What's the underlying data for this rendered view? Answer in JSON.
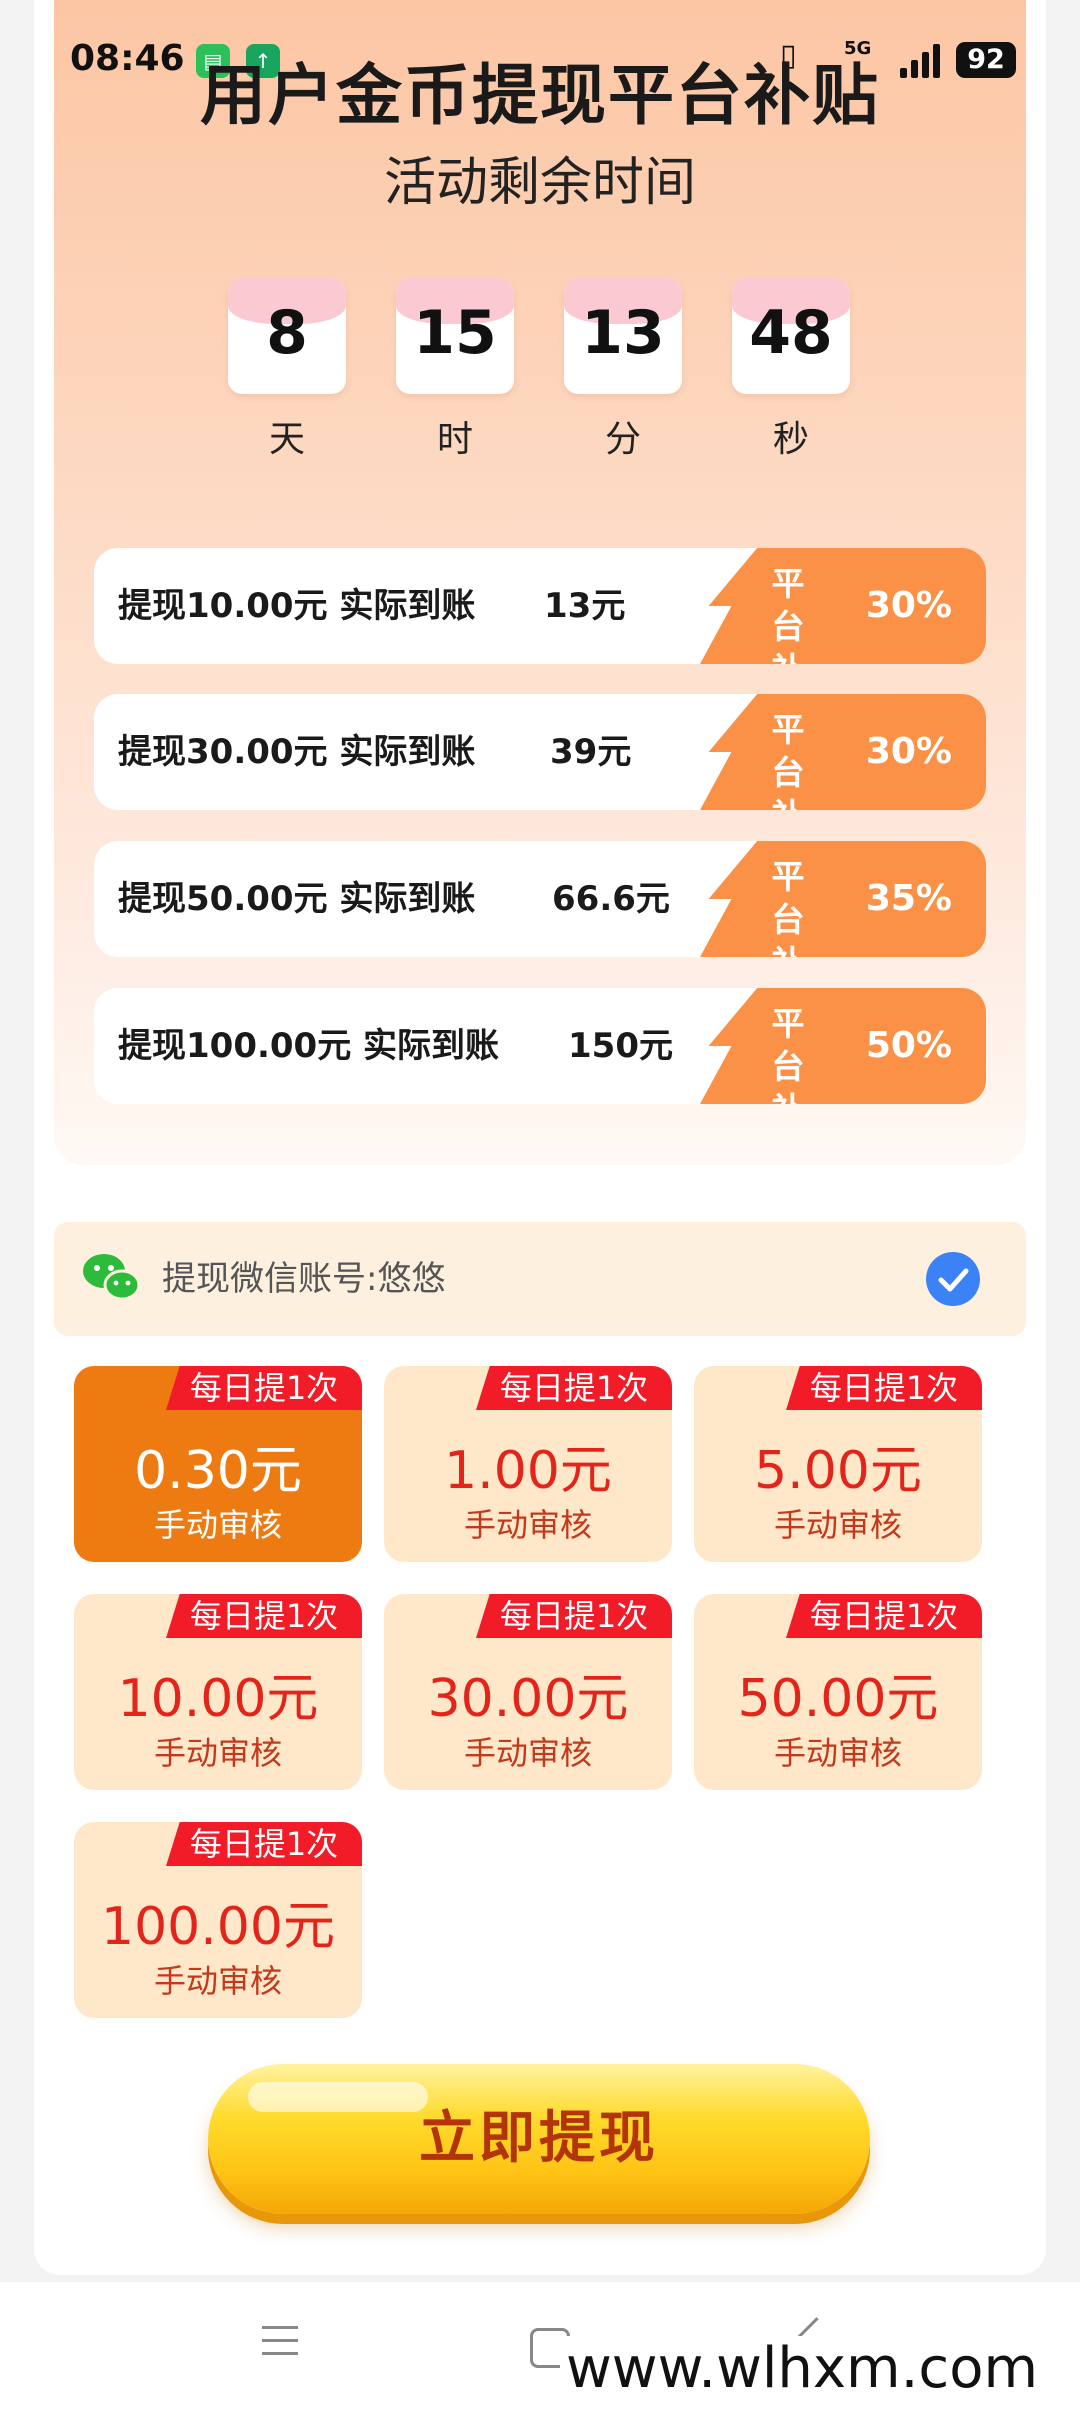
{
  "status_bar": {
    "time": "08:46",
    "network": "5G",
    "battery": "92"
  },
  "header": {
    "title": "用户金币提现平台补贴",
    "subtitle": "活动剩余时间"
  },
  "countdown": [
    {
      "value": "8",
      "unit": "天"
    },
    {
      "value": "15",
      "unit": "时"
    },
    {
      "value": "13",
      "unit": "分"
    },
    {
      "value": "48",
      "unit": "秒"
    }
  ],
  "offers": [
    {
      "text": "提现10.00元 实际到账",
      "amount": "13元",
      "badge": "平台补贴",
      "pct": "30%"
    },
    {
      "text": "提现30.00元 实际到账",
      "amount": "39元",
      "badge": "平台补贴",
      "pct": "30%"
    },
    {
      "text": "提现50.00元 实际到账",
      "amount": "66.6元",
      "badge": "平台补贴",
      "pct": "35%"
    },
    {
      "text": "提现100.00元 实际到账",
      "amount": "150元",
      "badge": "平台补贴",
      "pct": "50%"
    }
  ],
  "wechat": {
    "label": "提现微信账号:悠悠",
    "checked": true
  },
  "options": [
    {
      "tag": "每日提1次",
      "amount": "0.30元",
      "sub": "手动审核",
      "selected": true
    },
    {
      "tag": "每日提1次",
      "amount": "1.00元",
      "sub": "手动审核",
      "selected": false
    },
    {
      "tag": "每日提1次",
      "amount": "5.00元",
      "sub": "手动审核",
      "selected": false
    },
    {
      "tag": "每日提1次",
      "amount": "10.00元",
      "sub": "手动审核",
      "selected": false
    },
    {
      "tag": "每日提1次",
      "amount": "30.00元",
      "sub": "手动审核",
      "selected": false
    },
    {
      "tag": "每日提1次",
      "amount": "50.00元",
      "sub": "手动审核",
      "selected": false
    },
    {
      "tag": "每日提1次",
      "amount": "100.00元",
      "sub": "手动审核",
      "selected": false
    }
  ],
  "cta": {
    "label": "立即提现"
  },
  "watermark": "www.wlhxm.com",
  "colors": {
    "accent_orange": "#fb9147",
    "selected_option": "#ee7a12",
    "tag_red": "#f21b28",
    "check_blue": "#3b82f6"
  }
}
